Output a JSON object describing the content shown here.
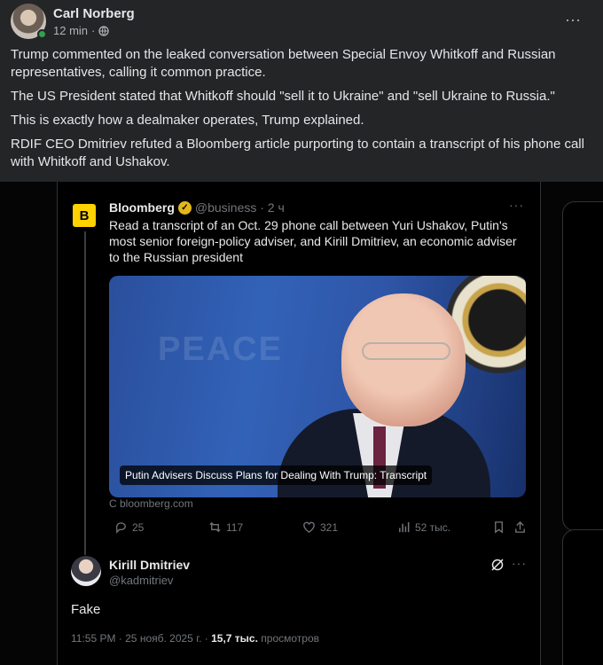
{
  "post": {
    "author": "Carl Norberg",
    "time": "12 min",
    "separator": "·",
    "more_label": "···",
    "paragraphs": [
      "Trump commented on the leaked conversation between Special Envoy Whitkoff and Russian representatives, calling it common practice.",
      "The US President stated that Whitkoff should \"sell it to Ukraine\" and \"sell Ukraine to Russia.\"",
      "This is exactly how a dealmaker operates, Trump explained.",
      "RDIF CEO Dmitriev refuted a Bloomberg article purporting to contain a transcript of his phone call with Whitkoff and Ushakov."
    ],
    "icons": {
      "privacy": "globe-icon",
      "menu": "more-horizontal-icon"
    },
    "colors": {
      "background": "#242526",
      "text": "#e4e6eb",
      "secondary": "#b0b3b8",
      "online": "#31a24c"
    }
  },
  "tweet": {
    "logo_letter": "B",
    "name": "Bloomberg",
    "handle": "@business · 2 ч",
    "dots": "···",
    "text": "Read a transcript of an Oct. 29 phone call between Yuri Ushakov, Putin's most senior foreign-policy adviser, and Kirill Dmitriev, an economic adviser to the Russian president",
    "photo_watermark": "PEACE",
    "photo_caption": "Putin Advisers Discuss Plans for Dealing With Trump: Transcript",
    "source": "C bloomberg.com",
    "stats": {
      "replies": "25",
      "reposts": "117",
      "likes": "321",
      "views": "52 тыс."
    },
    "colors": {
      "brand": "#ffd200",
      "verified": "#e2b719"
    }
  },
  "reply": {
    "name": "Kirill Dmitriev",
    "handle": "@kadmitriev",
    "dots": "···",
    "text": "Fake",
    "time_prefix": "11:55 PM · 25 нояб. 2025 г. · ",
    "views_count": "15,7 тыс.",
    "views_label": " просмотров"
  }
}
